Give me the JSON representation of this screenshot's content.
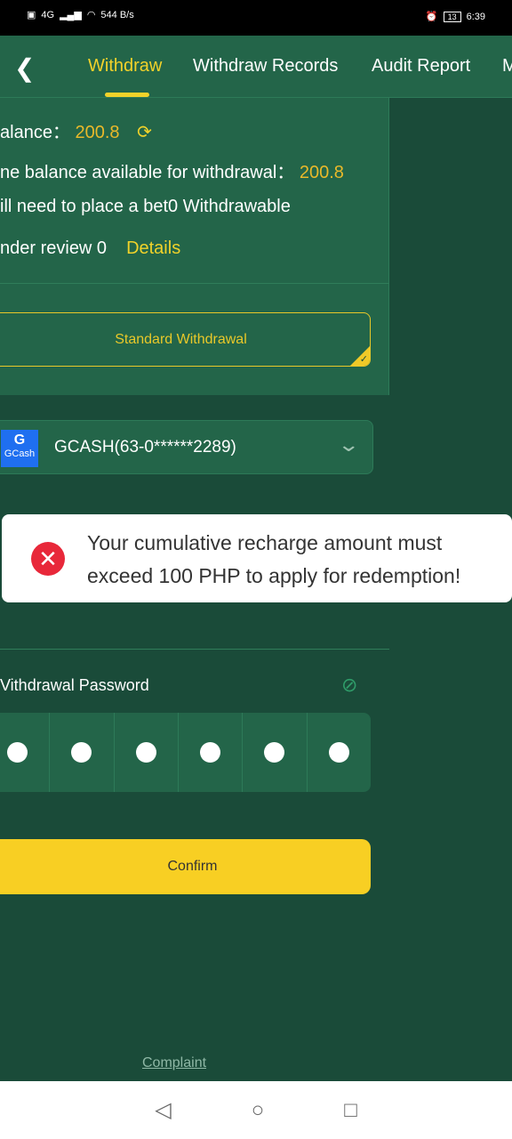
{
  "status_bar": {
    "network": "4G",
    "speed": "544 B/s",
    "battery": "13",
    "time": "6:39"
  },
  "header": {
    "tabs": [
      {
        "label": "Withdraw",
        "active": true
      },
      {
        "label": "Withdraw Records"
      },
      {
        "label": "Audit Report"
      },
      {
        "label": "M"
      }
    ]
  },
  "balance": {
    "label": "alance：",
    "value": "200.8",
    "available_label": "ne balance available for withdrawal：",
    "available_value": "200.8",
    "bet_text": "ill need to place a bet0  Withdrawable",
    "review_text": "nder review 0",
    "details": "Details"
  },
  "withdraw_type": "Standard Withdrawal",
  "account": {
    "logo": "GCash",
    "value": "GCASH(63-0******2289)"
  },
  "toast": {
    "message": "Your cumulative recharge amount must exceed 100 PHP to apply for redemption!"
  },
  "password": {
    "label": "Vithdrawal Password",
    "digits": 6
  },
  "confirm": "Confirm",
  "complaint": "Complaint",
  "colors": {
    "accent": "#f2d22a",
    "header": "#236549",
    "background": "#1a4b39",
    "error": "#e8283a"
  }
}
